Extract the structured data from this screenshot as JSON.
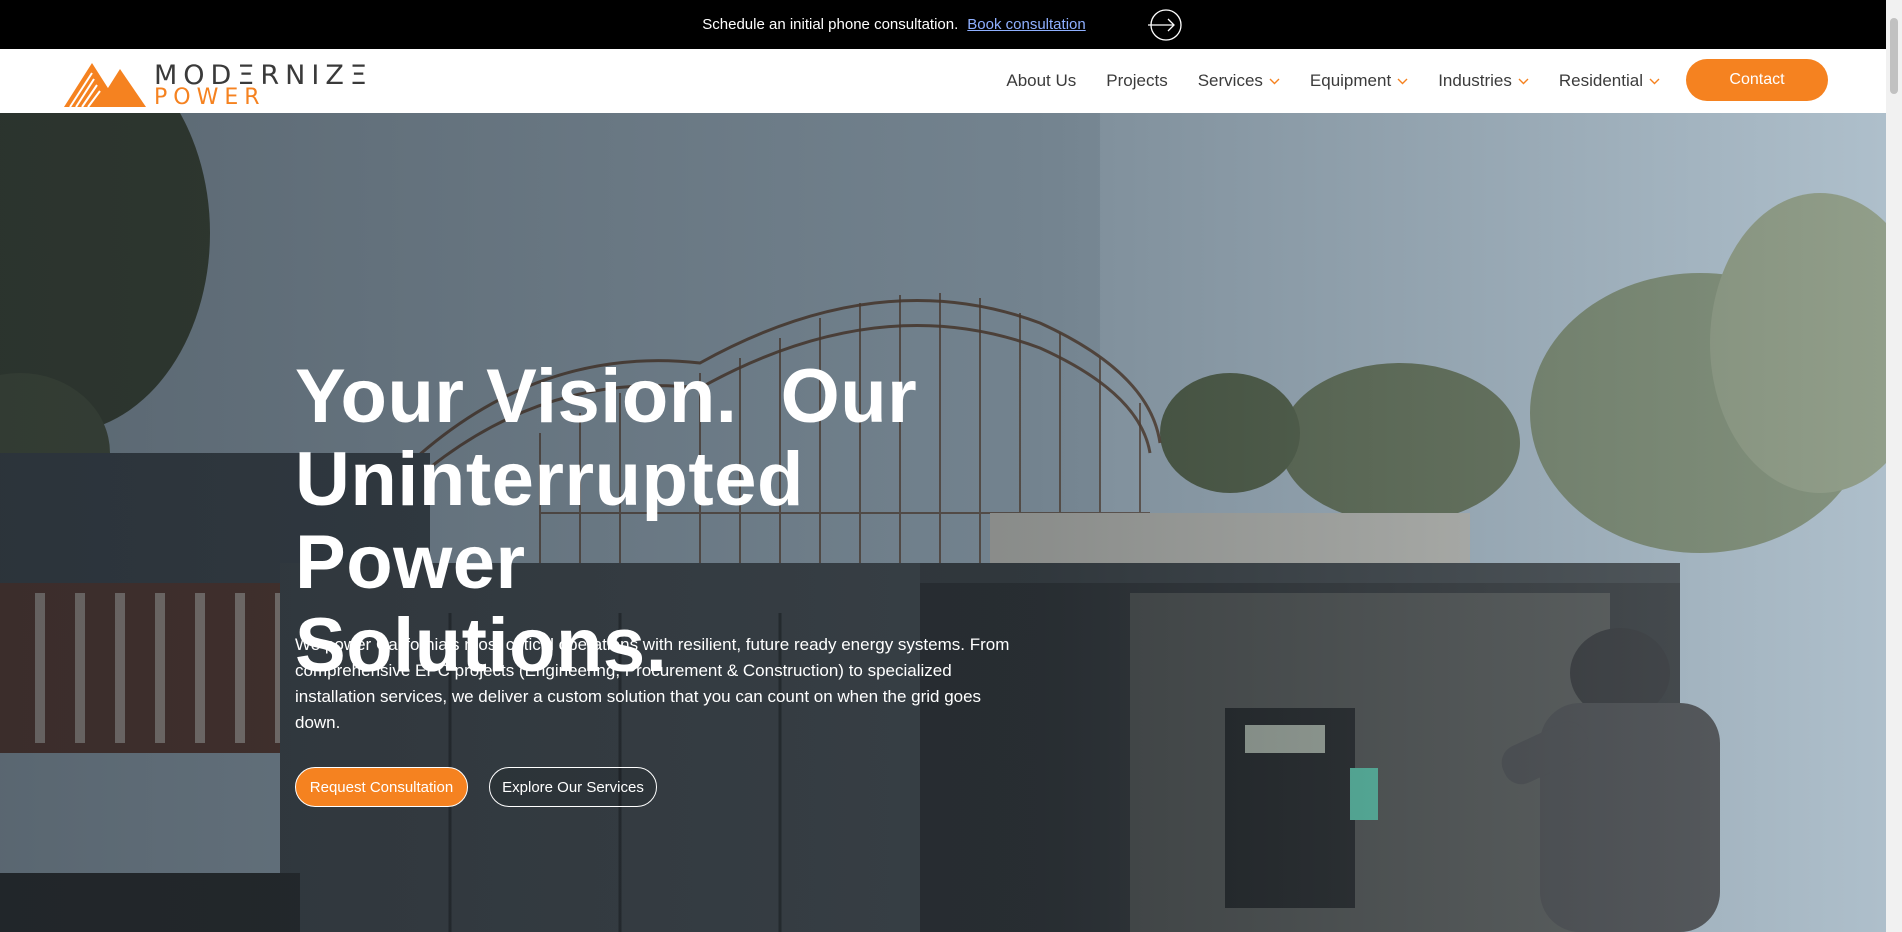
{
  "announcement": {
    "message": "Schedule an initial phone consultation.",
    "link_label": "Book consultation",
    "arrow_icon": "arrow-right-circle-icon"
  },
  "brand": {
    "name_line1": "MODΞRNIZΞ",
    "name_line2": "POWER",
    "accent_color": "#f58220"
  },
  "nav": {
    "items": [
      {
        "label": "About Us",
        "has_dropdown": false
      },
      {
        "label": "Projects",
        "has_dropdown": false
      },
      {
        "label": "Services",
        "has_dropdown": true
      },
      {
        "label": "Equipment",
        "has_dropdown": true
      },
      {
        "label": "Industries",
        "has_dropdown": true
      },
      {
        "label": "Residential",
        "has_dropdown": true
      }
    ],
    "contact_label": "Contact"
  },
  "hero": {
    "headline_line1": "Your Vision.  Our",
    "headline_line2": "Uninterrupted Power",
    "headline_line3": "Solutions.",
    "description": "We power California's most critical operations with resilient, future ready energy systems. From comprehensive EPC projects (Engineering, Procurement & Construction) to specialized installation services, we deliver a custom solution that you can count on when the grid goes down.",
    "primary_cta": "Request Consultation",
    "secondary_cta": "Explore Our Services"
  }
}
